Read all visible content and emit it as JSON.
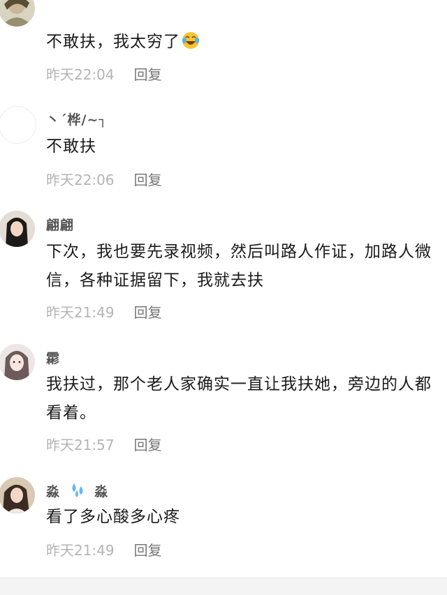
{
  "comments": [
    {
      "username": "",
      "text": "不敢扶，我太穷了",
      "emoji": "crying-laughing-emoji",
      "time": "昨天22:04",
      "reply": "回复",
      "avatar": "avatar-photo"
    },
    {
      "username": "丶´桦/~┐",
      "text": "不敢扶",
      "time": "昨天22:06",
      "reply": "回复",
      "avatar": "avatar-blank"
    },
    {
      "username": "翩翩",
      "text": "下次，我也要先录视频，然后叫路人作证，加路人微信，各种证据留下，我就去扶",
      "time": "昨天21:49",
      "reply": "回复",
      "avatar": "avatar-girl-dark-hair"
    },
    {
      "username": "霦",
      "text": "我扶过，那个老人家确实一直让我扶她，旁边的人都看着。",
      "time": "昨天21:57",
      "reply": "回复",
      "avatar": "avatar-illustrated-girl"
    },
    {
      "username": "淼",
      "username_suffix": "淼",
      "username_emoji": "sweat-droplets-emoji",
      "text": "看了多心酸多心疼",
      "time": "昨天21:49",
      "reply": "回复",
      "avatar": "avatar-woman-photo"
    }
  ],
  "colors": {
    "text": "#1a1a1a",
    "username": "#555555",
    "timestamp": "#b4b4b4",
    "reply": "#777777"
  }
}
